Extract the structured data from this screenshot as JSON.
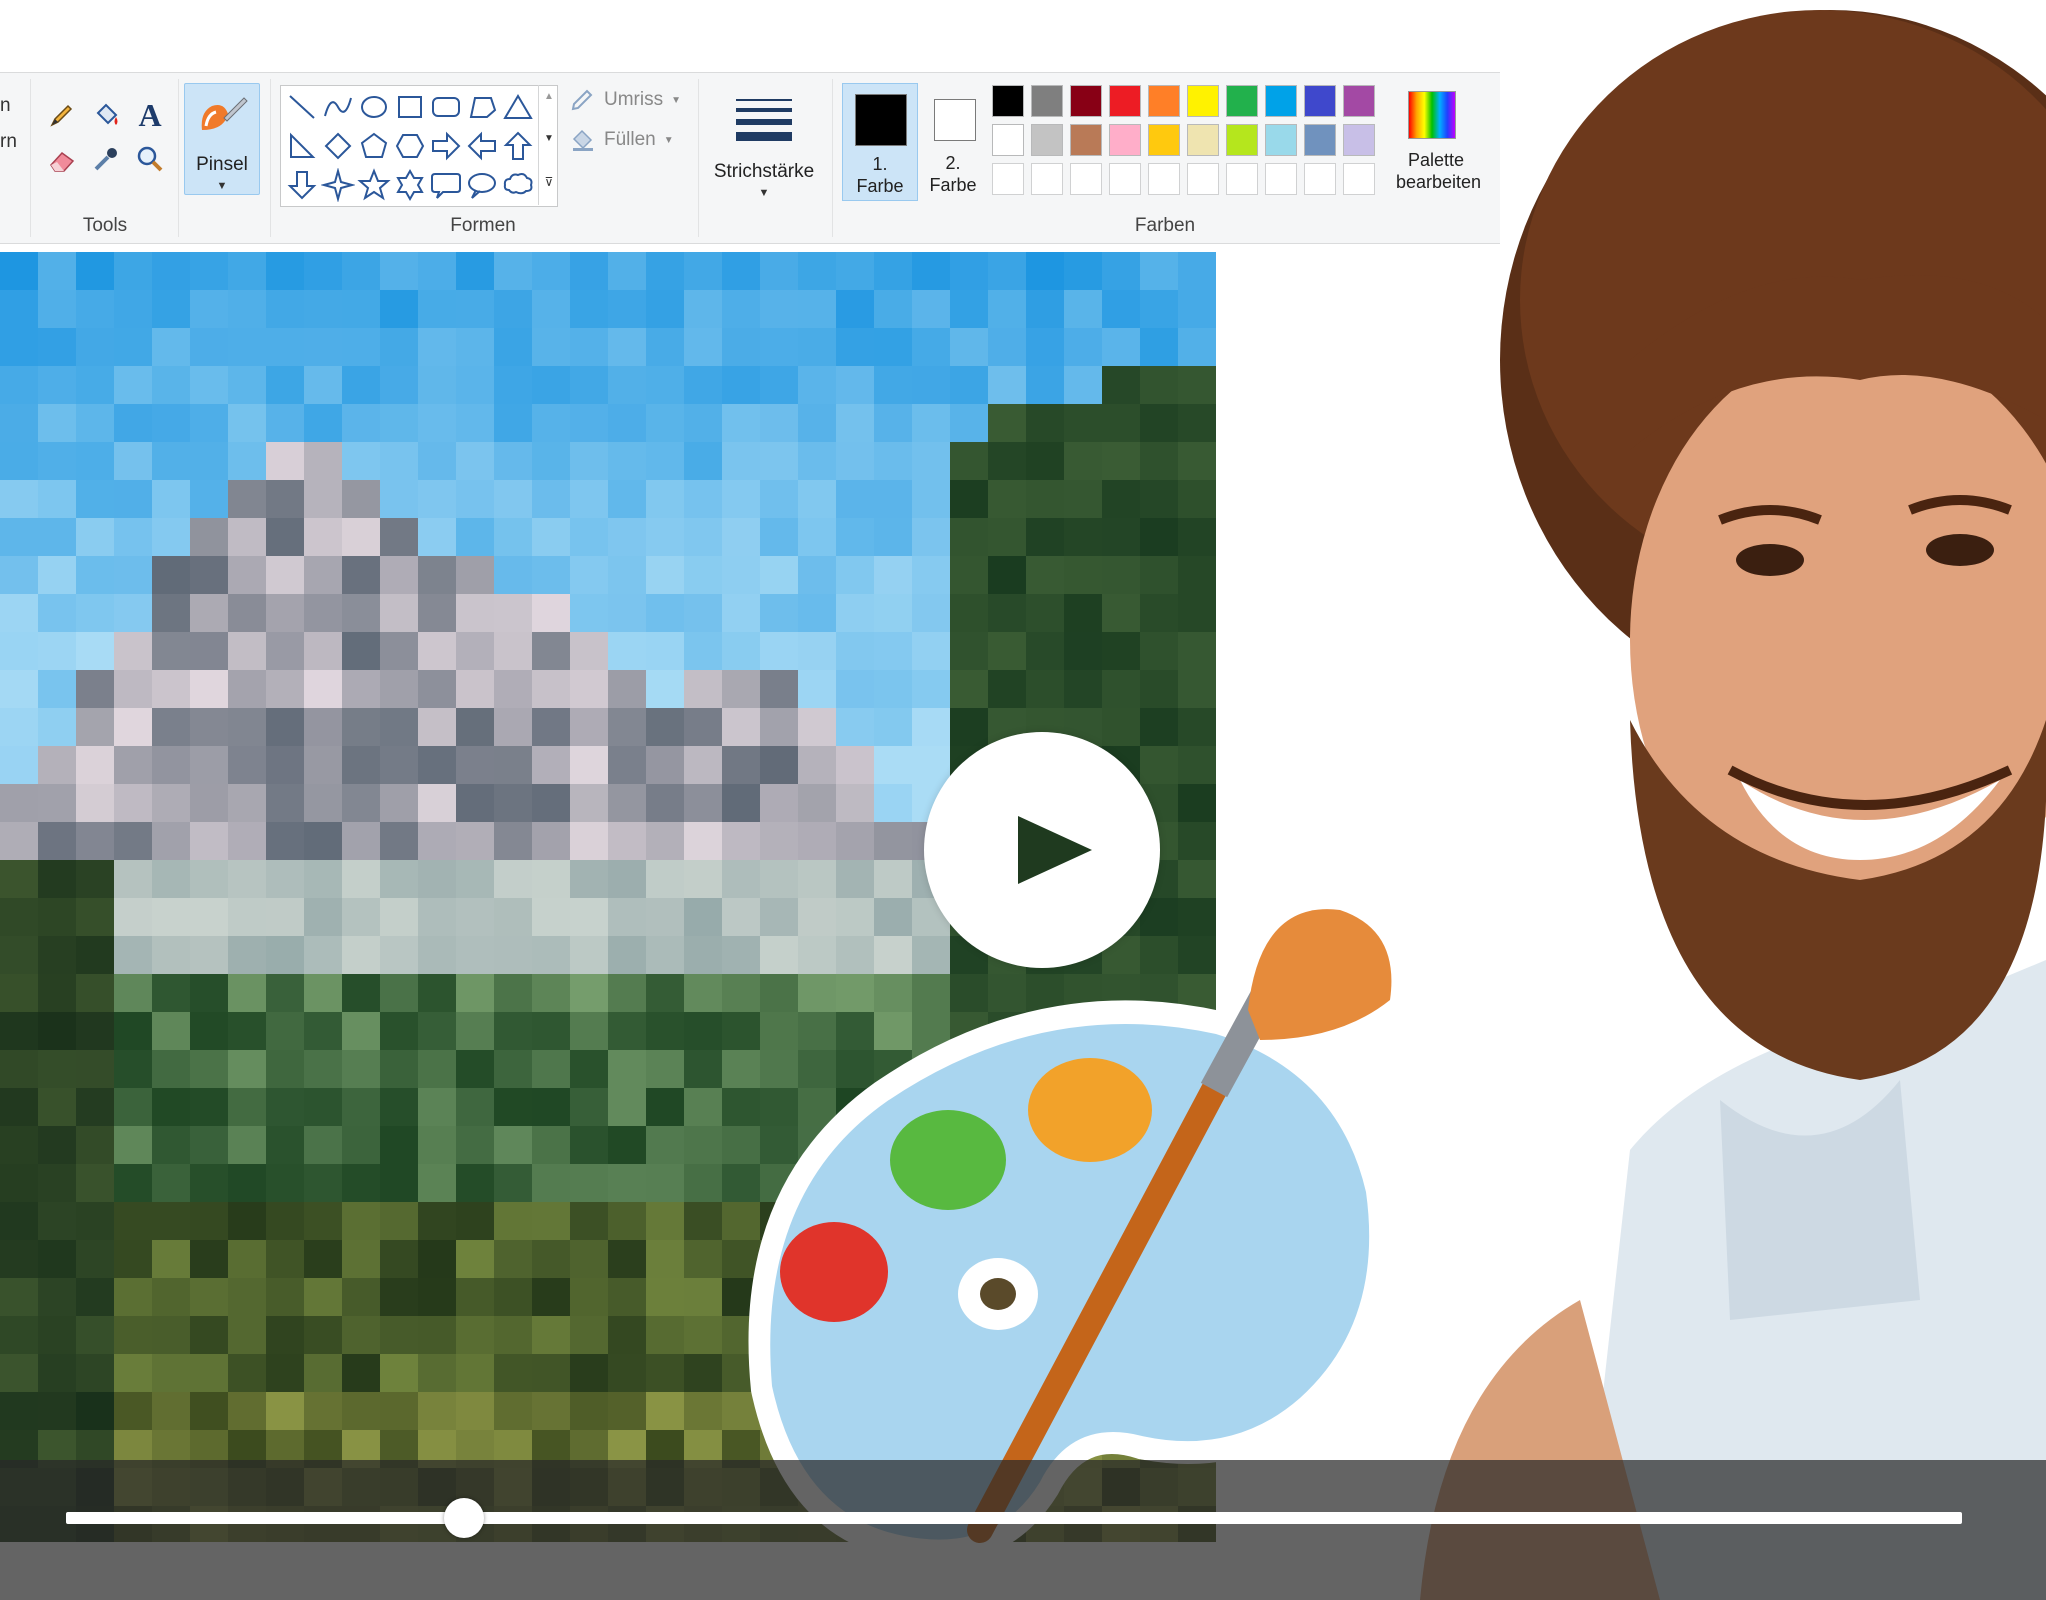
{
  "ribbon": {
    "prev_group_fragment": "rn",
    "tools": {
      "label": "Tools",
      "icons": [
        "pencil-icon",
        "fill-bucket-icon",
        "text-icon",
        "eraser-icon",
        "color-picker-icon",
        "magnifier-icon"
      ]
    },
    "brush": {
      "label": "Pinsel",
      "icon": "brush-icon"
    },
    "shapes": {
      "label": "Formen",
      "outline_label": "Umriss",
      "fill_label": "Füllen",
      "items": [
        "line",
        "curve",
        "oval",
        "rectangle",
        "rounded-rectangle",
        "polygon",
        "triangle",
        "right-triangle",
        "diamond",
        "pentagon",
        "hexagon",
        "right-arrow",
        "left-arrow",
        "up-arrow",
        "down-arrow",
        "four-point-star",
        "five-point-star",
        "six-point-star",
        "rounded-callout",
        "oval-callout",
        "cloud-callout"
      ]
    },
    "stroke": {
      "label": "Strichstärke"
    },
    "colors": {
      "label": "Farben",
      "color1": {
        "line1": "1.",
        "line2": "Farbe",
        "value": "#000000"
      },
      "color2": {
        "line1": "2.",
        "line2": "Farbe",
        "value": "#ffffff"
      },
      "edit_palette_label": "Palette bearbeiten",
      "palette_row1": [
        "#000000",
        "#7f7f7f",
        "#880015",
        "#ed1c24",
        "#ff7f27",
        "#fff200",
        "#22b14c",
        "#00a2e8",
        "#3f48cc",
        "#a349a4"
      ],
      "palette_row2": [
        "#ffffff",
        "#c3c3c3",
        "#b97a57",
        "#ffaec9",
        "#ffc90e",
        "#efe4b0",
        "#b5e61d",
        "#99d9ea",
        "#7092be",
        "#c8bfe7"
      ],
      "palette_row3_empty_count": 10
    }
  },
  "canvas": {
    "painting_subject": "pixelated mountain landscape"
  },
  "player": {
    "progress": 0.21,
    "play_icon": "play-icon"
  },
  "overlay": {
    "logo": "paint-palette-logo",
    "photo": "smiling-painter-photo"
  }
}
